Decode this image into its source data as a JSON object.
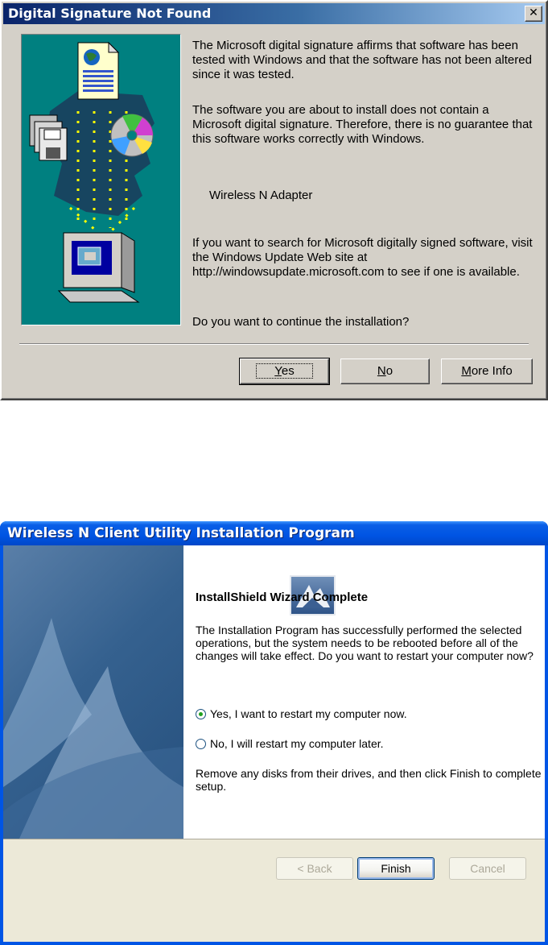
{
  "dialog1": {
    "title": "Digital Signature Not Found",
    "close_glyph": "✕",
    "paragraph1": "The Microsoft digital signature affirms that software has been tested with Windows and that the software has not been altered since it was tested.",
    "paragraph2": "The software you are about to install does not contain a Microsoft digital signature. Therefore,  there is no guarantee that this software works correctly with Windows.",
    "device_name": "Wireless N Adapter",
    "paragraph3": "If you want to search for Microsoft digitally signed software, visit the Windows Update Web site at http://windowsupdate.microsoft.com to see if one is available.",
    "question": "Do you want to continue the installation?",
    "buttons": {
      "yes": {
        "prefix": "",
        "accel": "Y",
        "rest": "es"
      },
      "no": {
        "prefix": "",
        "accel": "N",
        "rest": "o"
      },
      "more_info": {
        "prefix": "",
        "accel": "M",
        "rest": "ore Info"
      }
    },
    "icons": [
      "document-globe-icon",
      "floppy-disks-icon",
      "cd-disc-icon",
      "computer-icon"
    ]
  },
  "dialog2": {
    "title": "Wireless N Client Utility Installation Program",
    "heading": "InstallShield Wizard Complete",
    "body": "The Installation Program has successfully performed the selected operations, but the system needs to be rebooted before all of the changes will take effect. Do you want to restart your computer now?",
    "options": [
      {
        "label": "Yes, I want to restart my computer now.",
        "selected": true
      },
      {
        "label": "No, I will restart my computer later.",
        "selected": false
      }
    ],
    "remove_text": "Remove any disks from their drives, and then click Finish to complete setup.",
    "buttons": {
      "back": "< Back",
      "finish": "Finish",
      "cancel": "Cancel"
    },
    "icons": [
      "installshield-logo-icon"
    ]
  }
}
